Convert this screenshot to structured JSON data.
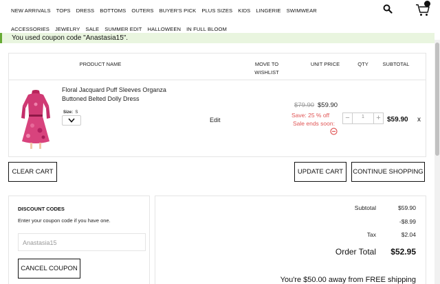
{
  "nav": {
    "row1": [
      "NEW ARRIVALS",
      "TOPS",
      "DRESS",
      "BOTTOMS",
      "OUTERS",
      "BUYER'S PICK",
      "PLUS SIZES",
      "KIDS",
      "LINGERIE",
      "SWIMWEAR"
    ],
    "row2": [
      "ACCESSORIES",
      "JEWELRY",
      "SALE",
      "SUMMER EDIT",
      "HALLOWEEN",
      "IN FULL BLOOM"
    ]
  },
  "notice": {
    "text": "You used coupon code \"Anastasia15\"."
  },
  "table": {
    "headers": {
      "product_name": "PRODUCT NAME",
      "move_to_wishlist": "MOVE TO WISHLIST",
      "unit_price": "UNIT PRICE",
      "qty": "QTY",
      "subtotal": "SUBTOTAL"
    }
  },
  "item": {
    "name": "Floral Jacquard Puff Sleeves Organza Buttoned Belted Dolly Dress",
    "size_label": "Size:",
    "size_value": "S",
    "edit": "Edit",
    "old_price": "$79.90",
    "new_price": "$59.90",
    "save": "Save: 25 % off",
    "sale_ends": "Sale ends soon:",
    "qty": "1",
    "subtotal": "$59.90",
    "remove": "x"
  },
  "buttons": {
    "clear_cart": "CLEAR CART",
    "update_cart": "UPDATE CART",
    "continue_shopping": "CONTINUE SHOPPING",
    "cancel_coupon": "CANCEL COUPON"
  },
  "discount": {
    "title": "DISCOUNT CODES",
    "subtitle": "Enter your coupon code if you have one.",
    "code_value": "Anastasia15"
  },
  "totals": {
    "subtotal_label": "Subtotal",
    "subtotal_value": "$59.90",
    "discount_value": "-$8.99",
    "tax_label": "Tax",
    "tax_value": "$2.04",
    "order_total_label": "Order Total",
    "order_total_value": "$52.95",
    "free_shipping": "You're $50.00 away from FREE shipping"
  },
  "colors": {
    "sale_red": "#e05555",
    "notice_bg": "#e9f5df",
    "notice_border": "#66aa33"
  }
}
